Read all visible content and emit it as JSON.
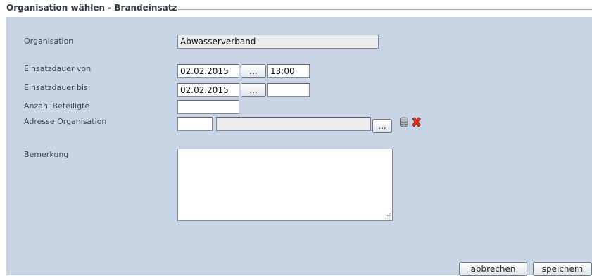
{
  "form": {
    "title": "Organisation wählen - Brandeinsatz",
    "organisation": {
      "label": "Organisation",
      "value": "Abwasserverband"
    },
    "einsatz_von": {
      "label": "Einsatzdauer von",
      "date": "02.02.2015",
      "button": "...",
      "time": "13:00"
    },
    "einsatz_bis": {
      "label": "Einsatzdauer bis",
      "date": "02.02.2015",
      "button": "...",
      "time": ""
    },
    "anzahl": {
      "label": "Anzahl Beteiligte",
      "value": ""
    },
    "adresse": {
      "label": "Adresse Organisation",
      "code": "",
      "text": "",
      "button": "...",
      "icons": [
        "database-icon",
        "delete-x-icon"
      ]
    },
    "bemerkung": {
      "label": "Bemerkung",
      "value": ""
    }
  },
  "actions": {
    "cancel": "abbrechen",
    "save": "speichern"
  },
  "colors": {
    "panel_bg": "#c9d5e5",
    "delete_icon": "#e03020"
  }
}
